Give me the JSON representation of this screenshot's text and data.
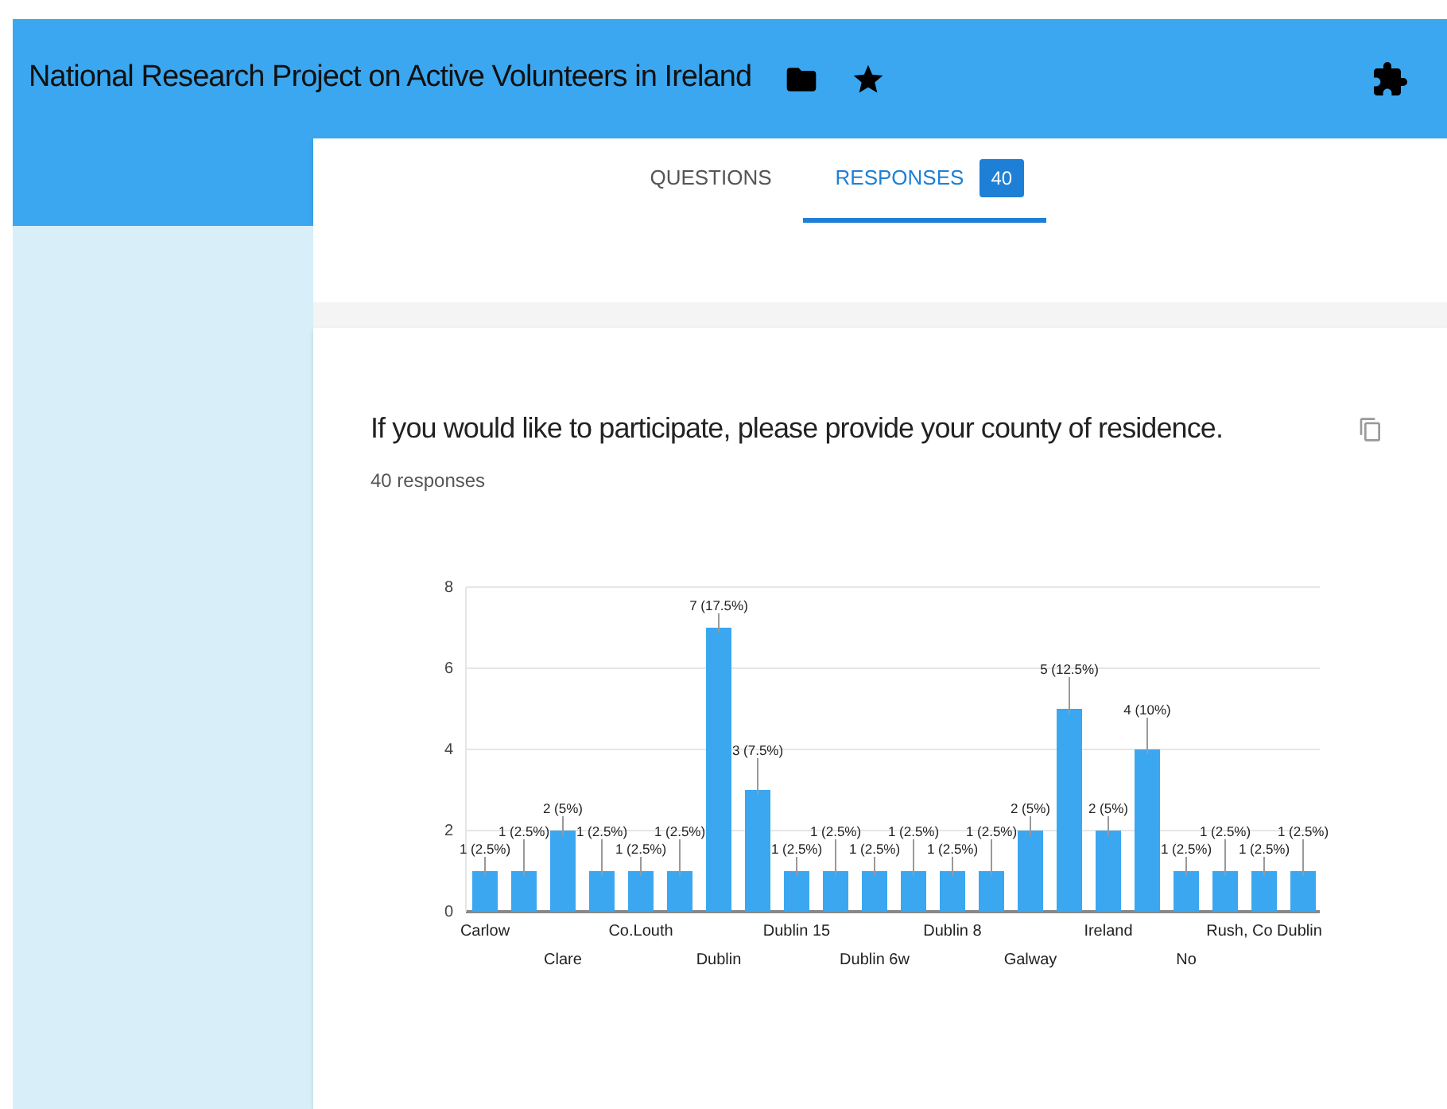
{
  "header": {
    "title": "National Research Project on Active Volunteers in Ireland"
  },
  "tabs": [
    {
      "label": "QUESTIONS",
      "selected": false
    },
    {
      "label": "RESPONSES",
      "selected": true,
      "badge": "40"
    }
  ],
  "question": {
    "title": "If you would like to participate, please provide your county of residence.",
    "count": "40 responses",
    "chart_data": {
      "type": "bar",
      "categories": [
        "Carlow",
        null,
        "Clare",
        null,
        "Co.Louth",
        null,
        "Dublin",
        null,
        "Dublin 15",
        null,
        "Dublin 6w",
        null,
        "Dublin 8",
        null,
        "Galway",
        null,
        "Ireland",
        null,
        "No",
        null,
        "Rush, Co Dublin",
        null
      ],
      "values": [
        1,
        1,
        2,
        1,
        1,
        1,
        7,
        3,
        1,
        1,
        1,
        1,
        1,
        1,
        2,
        5,
        2,
        4,
        1,
        1,
        1,
        1
      ],
      "ylim": [
        0,
        8
      ],
      "yticks": [
        0,
        2,
        4,
        6,
        8
      ],
      "grid": true,
      "value_labels": [
        "1 (2.5%)",
        "1 (2.5%)",
        "2 (5%)",
        "1 (2.5%)",
        "1 (2.5%)",
        "1 (2.5%)",
        "7 (17.5%)",
        "3 (7.5%)",
        "1 (2.5%)",
        "1 (2.5%)",
        "1 (2.5%)",
        "1 (2.5%)",
        "1 (2.5%)",
        "1 (2.5%)",
        "2 (5%)",
        "5 (12.5%)",
        "2 (5%)",
        "4 (10%)",
        "1 (2.5%)",
        "1 (2.5%)",
        "1 (2.5%)",
        "1 (2.5%)"
      ]
    }
  }
}
